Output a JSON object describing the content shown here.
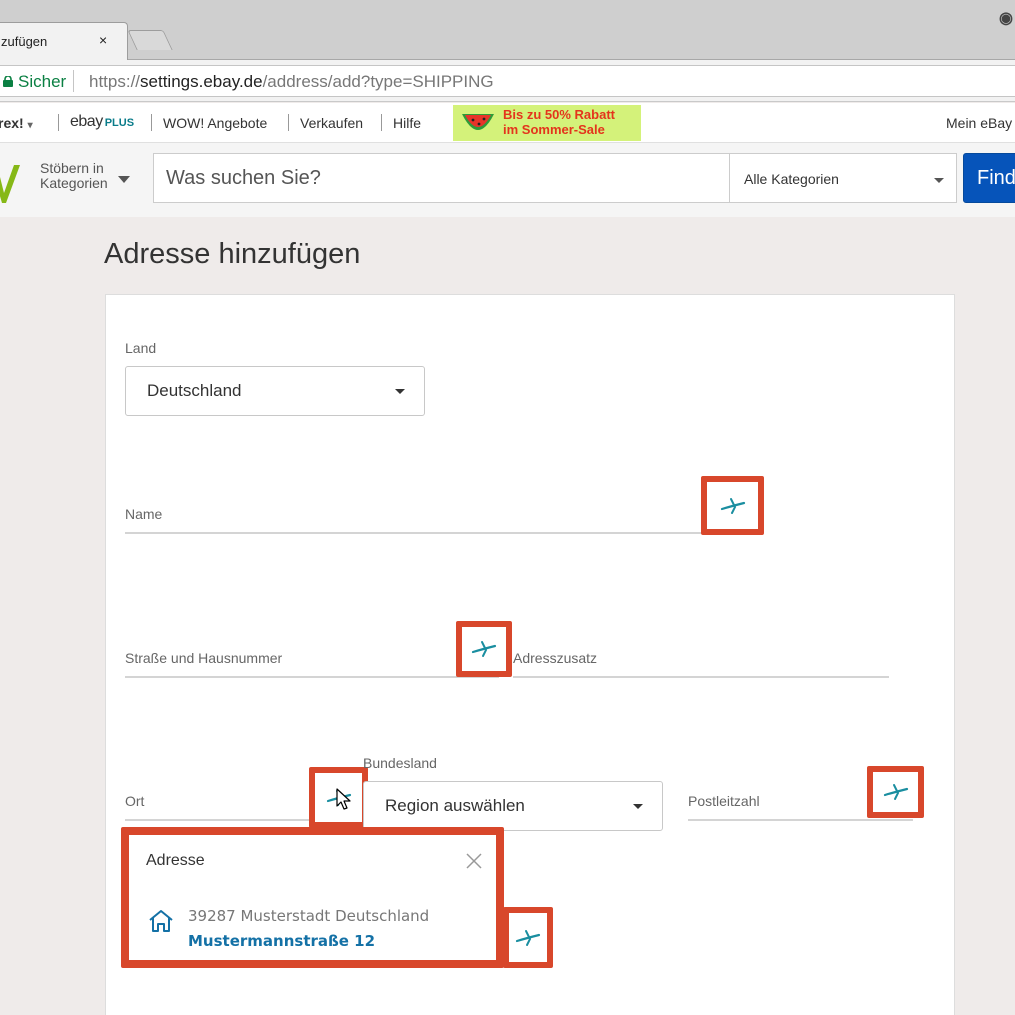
{
  "browser": {
    "tab_title": "zufügen",
    "tab_close": "×",
    "secure_label": "Sicher",
    "url_scheme": "https://",
    "url_host": "settings.ebay.de",
    "url_path": "/address/add?type=SHIPPING",
    "profile_icon": "profile-icon"
  },
  "topnav": {
    "left_fragment": "rex!",
    "left_caret": "▾",
    "plus_logo_text": "ebay",
    "plus_logo_suffix": "PLUS",
    "wow": "WOW! Angebote",
    "sell": "Verkaufen",
    "help": "Hilfe",
    "promo_line1": "Bis zu 50% Rabatt",
    "promo_line2": "im Sommer-Sale",
    "my_ebay": "Mein eBay"
  },
  "search": {
    "browse_line1": "Stöbern in",
    "browse_line2": "Kategorien",
    "placeholder": "Was suchen Sie?",
    "category": "Alle Kategorien",
    "find_label": "Finden"
  },
  "page": {
    "title": "Adresse hinzufügen"
  },
  "form": {
    "country_label": "Land",
    "country_value": "Deutschland",
    "name_label": "Name",
    "street_label": "Straße und Hausnummer",
    "address_extra_label": "Adresszusatz",
    "city_label": "Ort",
    "state_label": "Bundesland",
    "state_value": "Region auswählen",
    "zip_label": "Postleitzahl"
  },
  "suggestion": {
    "header": "Adresse",
    "line1": "39287 Musterstadt Deutschland",
    "line2": "Mustermannstraße 12"
  },
  "colors": {
    "highlight": "#d8472b",
    "autofill_icon": "#1a8ea0",
    "link": "#1471a6",
    "find_button": "#0654ba",
    "ebay_green": "#86b817"
  }
}
